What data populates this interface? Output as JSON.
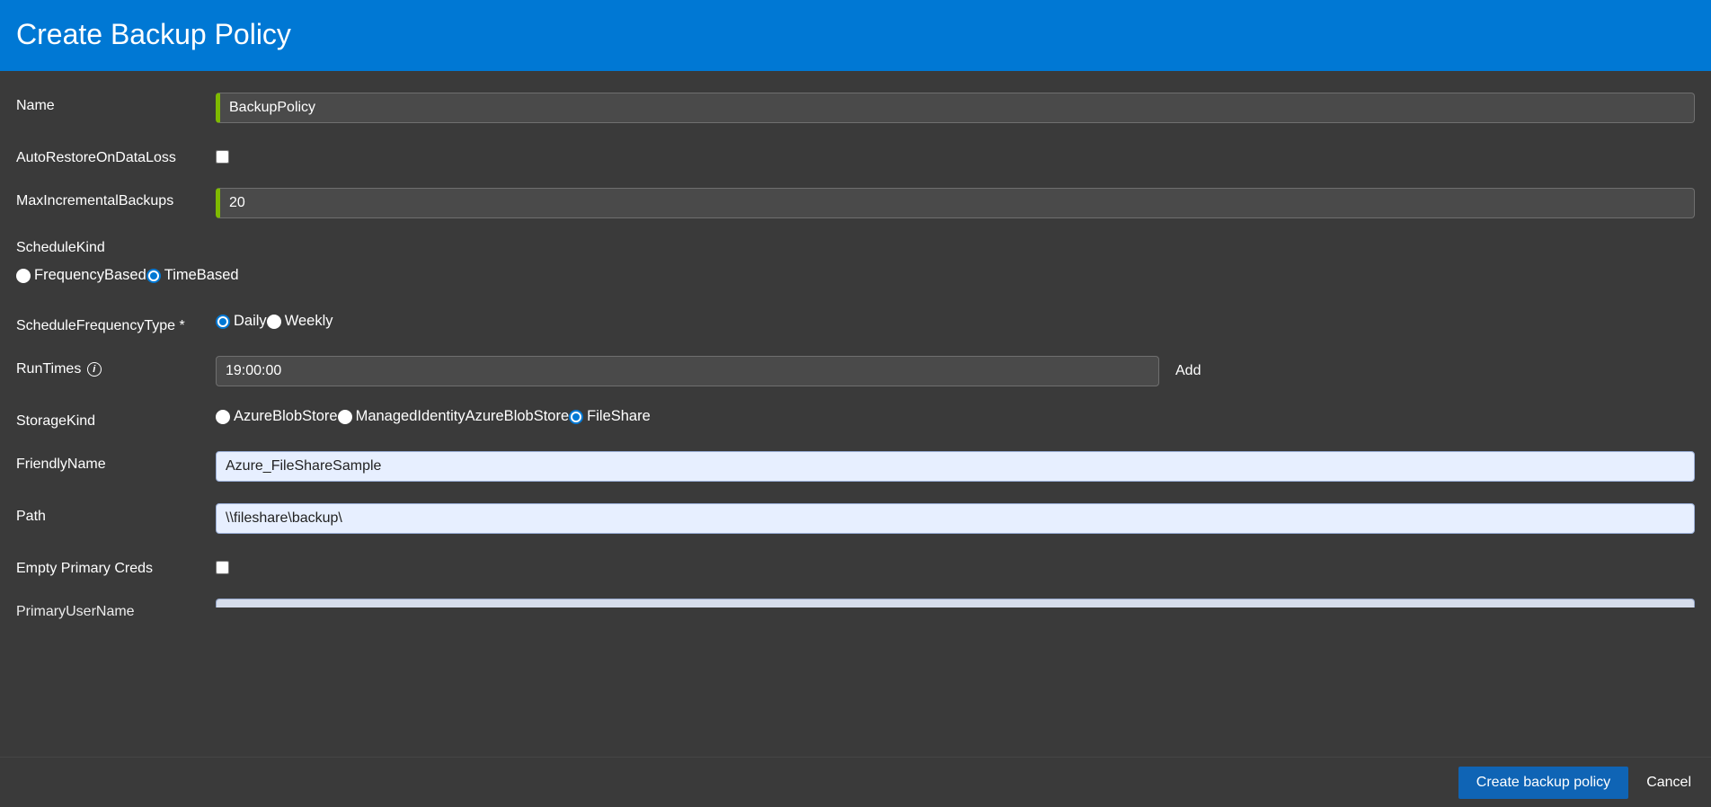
{
  "header": {
    "title": "Create Backup Policy"
  },
  "form": {
    "name": {
      "label": "Name",
      "value": "BackupPolicy"
    },
    "autoRestore": {
      "label": "AutoRestoreOnDataLoss",
      "checked": false
    },
    "maxIncremental": {
      "label": "MaxIncrementalBackups",
      "value": "20"
    },
    "scheduleKind": {
      "label": "ScheduleKind",
      "options": [
        {
          "label": "FrequencyBased",
          "checked": false
        },
        {
          "label": "TimeBased",
          "checked": true
        }
      ]
    },
    "scheduleFrequencyType": {
      "label": "ScheduleFrequencyType *",
      "options": [
        {
          "label": "Daily",
          "checked": true
        },
        {
          "label": "Weekly",
          "checked": false
        }
      ]
    },
    "runTimes": {
      "label": "RunTimes",
      "value": "19:00:00",
      "addLabel": "Add"
    },
    "storageKind": {
      "label": "StorageKind",
      "options": [
        {
          "label": "AzureBlobStore",
          "checked": false
        },
        {
          "label": "ManagedIdentityAzureBlobStore",
          "checked": false
        },
        {
          "label": "FileShare",
          "checked": true
        }
      ]
    },
    "friendlyName": {
      "label": "FriendlyName",
      "value": "Azure_FileShareSample"
    },
    "path": {
      "label": "Path",
      "value": "\\\\fileshare\\backup\\"
    },
    "emptyPrimaryCreds": {
      "label": "Empty Primary Creds",
      "checked": false
    },
    "primaryUserName": {
      "label": "PrimaryUserName",
      "value": ""
    }
  },
  "footer": {
    "primary": "Create backup policy",
    "secondary": "Cancel"
  }
}
